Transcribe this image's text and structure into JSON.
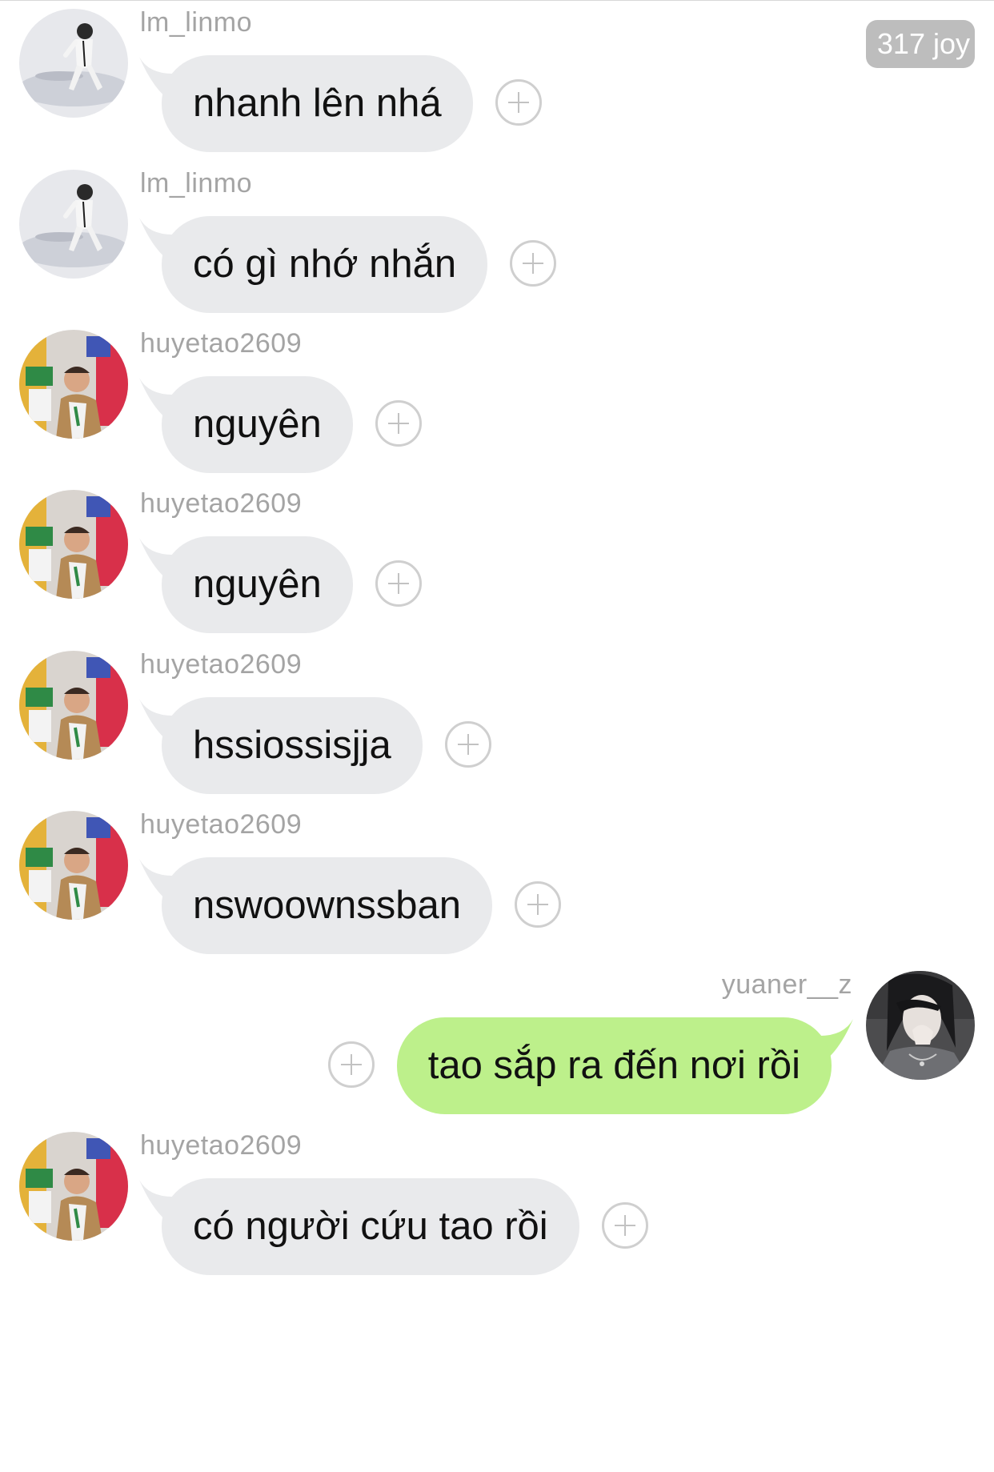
{
  "joy_badge": "317 joy",
  "messages": [
    {
      "direction": "in",
      "avatar": "avatar-lm-linmo",
      "username": "lm_linmo",
      "text": "nhanh lên nhá"
    },
    {
      "direction": "in",
      "avatar": "avatar-lm-linmo",
      "username": "lm_linmo",
      "text": "có gì nhớ nhắn"
    },
    {
      "direction": "in",
      "avatar": "avatar-huyetao2609",
      "username": "huyetao2609",
      "text": "nguyên"
    },
    {
      "direction": "in",
      "avatar": "avatar-huyetao2609",
      "username": "huyetao2609",
      "text": "nguyên"
    },
    {
      "direction": "in",
      "avatar": "avatar-huyetao2609",
      "username": "huyetao2609",
      "text": "hssiossisjja"
    },
    {
      "direction": "in",
      "avatar": "avatar-huyetao2609",
      "username": "huyetao2609",
      "text": "nswoownssban"
    },
    {
      "direction": "out",
      "avatar": "avatar-yuaner-z",
      "username": "yuaner__z",
      "text": "tao sắp ra đến nơi rồi"
    },
    {
      "direction": "in",
      "avatar": "avatar-huyetao2609",
      "username": "huyetao2609",
      "text": "có người cứu tao rồi"
    }
  ],
  "icons": {
    "react_button": "add-reaction-icon"
  },
  "colors": {
    "incoming_bubble": "#e9eaec",
    "outgoing_bubble": "#bdf08b",
    "username_text": "#a4a4a4",
    "badge_background": "#bdbdbd"
  }
}
